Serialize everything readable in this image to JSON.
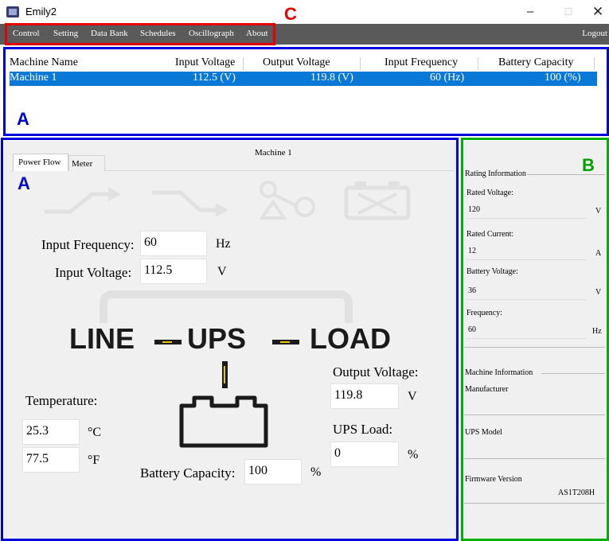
{
  "window": {
    "title": "Emily2",
    "min_glyph": "–",
    "max_glyph": "☐",
    "close_glyph": "✕"
  },
  "menu": {
    "items": [
      "Control",
      "Setting",
      "Data Bank",
      "Schedules",
      "Oscillograph",
      "About"
    ],
    "logout": "Logout"
  },
  "annotations": {
    "c": "C",
    "a_top": "A",
    "a_left": "A",
    "b": "B"
  },
  "machine_table": {
    "headers": [
      "Machine Name",
      "Input Voltage",
      "Output Voltage",
      "Input Frequency",
      "Battery Capacity"
    ],
    "rows": [
      [
        "Machine 1",
        "112.5 (V)",
        "119.8 (V)",
        "60 (Hz)",
        "100 (%)"
      ]
    ]
  },
  "power_panel": {
    "title": "Machine 1",
    "tabs": [
      "Power Flow",
      "Meter"
    ],
    "input_frequency_label": "Input Frequency:",
    "input_frequency": "60",
    "input_frequency_unit": "Hz",
    "input_voltage_label": "Input Voltage:",
    "input_voltage": "112.5",
    "input_voltage_unit": "V",
    "line": "LINE",
    "ups": "UPS",
    "load": "LOAD",
    "output_voltage_label": "Output Voltage:",
    "output_voltage": "119.8",
    "output_voltage_unit": "V",
    "ups_load_label": "UPS Load:",
    "ups_load": "0",
    "ups_load_unit": "%",
    "temperature_label": "Temperature:",
    "temp_c": "25.3",
    "temp_c_unit": "°C",
    "temp_f": "77.5",
    "temp_f_unit": "°F",
    "battery_capacity_label": "Battery Capacity:",
    "battery_capacity": "100",
    "battery_capacity_unit": "%"
  },
  "rating": {
    "heading": "Rating Information",
    "rated_voltage_label": "Rated Voltage:",
    "rated_voltage": "120",
    "rated_voltage_unit": "V",
    "rated_current_label": "Rated Current:",
    "rated_current": "12",
    "rated_current_unit": "A",
    "battery_voltage_label": "Battery Voltage:",
    "battery_voltage": "36",
    "battery_voltage_unit": "V",
    "frequency_label": "Frequency:",
    "frequency": "60",
    "frequency_unit": "Hz"
  },
  "machine_info": {
    "heading": "Machine Information",
    "manufacturer_label": "Manufacturer",
    "manufacturer": "",
    "ups_model_label": "UPS Model",
    "ups_model": "",
    "firmware_label": "Firmware Version",
    "firmware": "AS1T208H"
  },
  "colors": {
    "selection": "#0a78d7",
    "menubar": "#5a5a5a",
    "annot_red": "#e50000",
    "annot_blue": "#0000dd",
    "annot_green": "#00b000",
    "flow_accent": "#e8c800"
  }
}
